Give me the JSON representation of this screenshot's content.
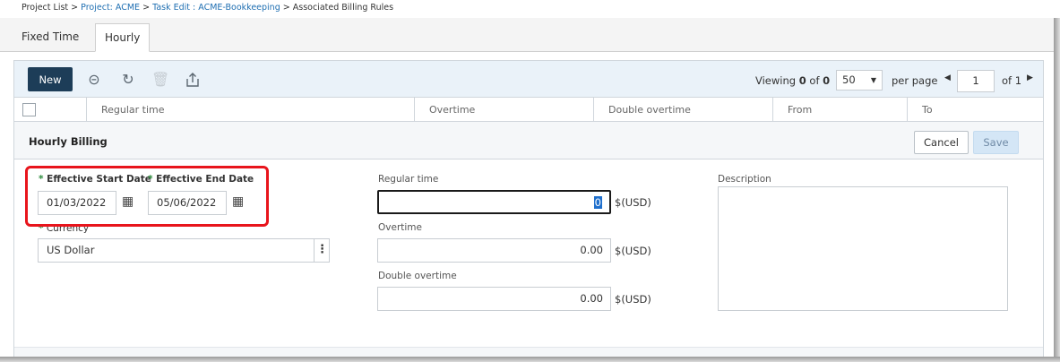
{
  "breadcrumb": {
    "project_list": "Project List",
    "sep": ">",
    "project": "Project: ACME",
    "task": "Task Edit : ACME-Bookkeeping",
    "current": "Associated Billing Rules"
  },
  "tabs": [
    {
      "label": "Fixed Time",
      "active": false
    },
    {
      "label": "Hourly",
      "active": true
    }
  ],
  "toolbar": {
    "new_label": "New",
    "viewing_prefix": "Viewing",
    "viewing_from": "0",
    "viewing_of": "of",
    "viewing_total": "0",
    "page_size": "50",
    "per_page": "per page",
    "current_page": "1",
    "of_pages": "of 1"
  },
  "columns": [
    "Regular time",
    "Overtime",
    "Double overtime",
    "From",
    "To"
  ],
  "form": {
    "title": "Hourly Billing",
    "cancel_label": "Cancel",
    "save_label": "Save",
    "start_date_label": "Effective Start Date",
    "start_date_value": "01/03/2022",
    "end_date_label": "Effective End Date",
    "end_date_value": "05/06/2022",
    "currency_label": "Currency",
    "currency_value": "US Dollar",
    "regular_label": "Regular time",
    "regular_value": "0",
    "overtime_label": "Overtime",
    "overtime_value": "0.00",
    "double_label": "Double overtime",
    "double_value": "0.00",
    "unit": "$(USD)",
    "description_label": "Description",
    "required_mark": "*"
  },
  "colors": {
    "accent": "#1d3d58",
    "highlight": "#e8141c",
    "link": "#1f6fb2"
  }
}
